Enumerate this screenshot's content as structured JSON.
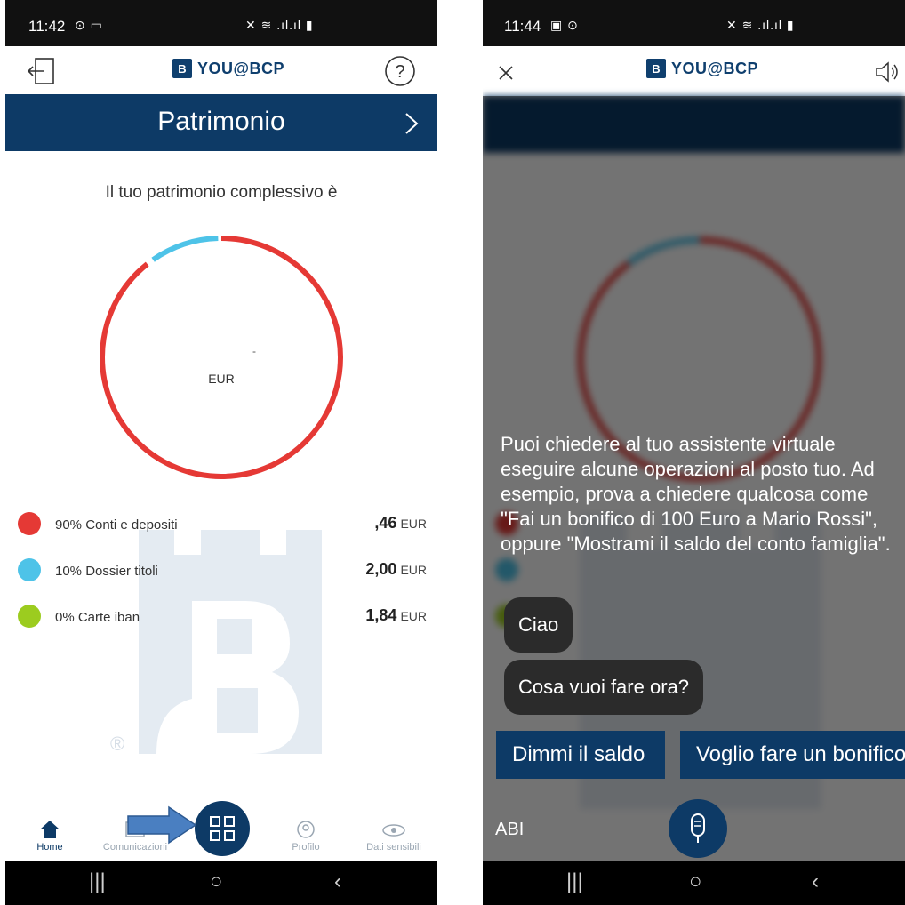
{
  "left": {
    "status": {
      "time": "11:42",
      "icons": "⊙ ▭",
      "right_icons": "✕ ≋ .ıl.ıl ▮"
    },
    "brand": "YOU@BCP",
    "back_icon": "exit-icon",
    "help_icon": "help-icon",
    "section_title": "Patrimonio",
    "heading": "Il tuo patrimonio complessivo è",
    "donut": {
      "center_dash": "-",
      "currency": "EUR"
    },
    "legend": [
      {
        "label": "90% Conti e depositi",
        "amount": ",46",
        "currency": "EUR",
        "color": "#e53935",
        "pct": 90
      },
      {
        "label": "10% Dossier titoli",
        "amount": "2,00",
        "currency": "EUR",
        "color": "#4ec3e8",
        "pct": 10
      },
      {
        "label": "0% Carte iban",
        "amount": "1,84",
        "currency": "EUR",
        "color": "#9ccc1f",
        "pct": 0
      }
    ],
    "watermark_r": "®",
    "nav": [
      {
        "label": "Home"
      },
      {
        "label": "Comunicazioni"
      },
      {
        "label": "Profilo"
      },
      {
        "label": "Dati sensibili"
      }
    ]
  },
  "right": {
    "status": {
      "time": "11:44",
      "icons": "▣ ⊙",
      "right_icons": "✕ ≋ .ıl.ıl ▮"
    },
    "brand": "YOU@BCP",
    "close_icon": "close-icon",
    "speaker_icon": "speaker-icon",
    "intro_text": "Puoi chiedere al tuo assistente virtuale eseguire alcune operazioni al posto tuo. Ad esempio, prova a chiedere qualcosa come \"Fai un bonifico di 100 Euro a Mario Rossi\", oppure \"Mostrami il saldo del conto famiglia\".",
    "bubble1": "Ciao",
    "bubble2": "Cosa vuoi fare ora?",
    "btn1": "Dimmi il saldo",
    "btn2": "Voglio fare un bonifico",
    "keyboard_toggle": "AB"
  },
  "colors": {
    "brand_blue": "#0d3a66",
    "red": "#e53935",
    "cyan": "#4ec3e8",
    "green": "#9ccc1f"
  }
}
